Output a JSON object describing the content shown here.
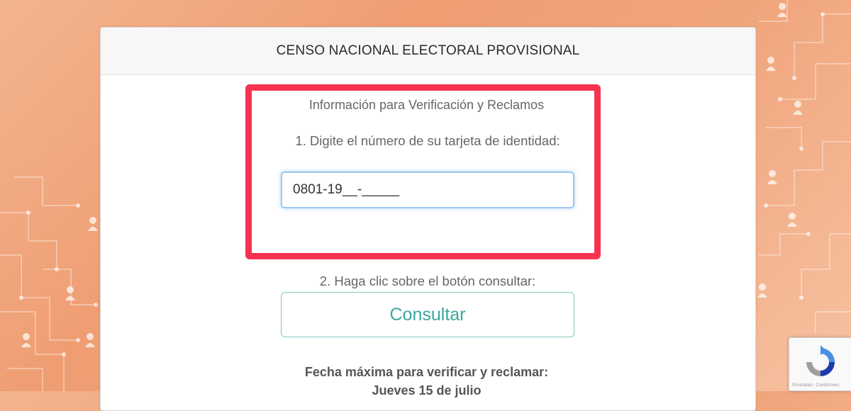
{
  "header": {
    "title": "CENSO NACIONAL ELECTORAL PROVISIONAL"
  },
  "form": {
    "section_title": "Información para Verificación y Reclamos",
    "step1_label": "1. Digite el número de su tarjeta de identidad:",
    "id_input_value": "0801-19__-_____",
    "step2_label": "2. Haga clic sobre el botón consultar:",
    "consultar_label": "Consultar",
    "deadline_label": "Fecha máxima para verificar y reclamar:",
    "deadline_date": "Jueves 15 de julio"
  },
  "recaptcha": {
    "footer": "Privacidad - Condiciones"
  },
  "colors": {
    "highlight": "#f53350",
    "button_text": "#3aa79d",
    "background": "#f0a47b"
  },
  "icons": {
    "background_person": "person-icon",
    "recaptcha": "recaptcha-icon"
  }
}
